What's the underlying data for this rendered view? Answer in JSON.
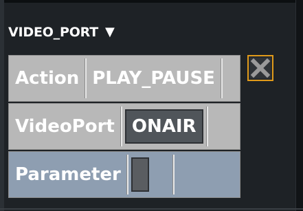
{
  "block": {
    "title": "VIDEO_PORT",
    "toggle_glyph": "▼"
  },
  "rows": {
    "action": {
      "label": "Action",
      "value": "PLAY_PAUSE"
    },
    "videoport": {
      "label": "VideoPort",
      "value": "ONAIR"
    },
    "parameter": {
      "label": "Parameter",
      "value": ""
    }
  },
  "icons": {
    "delete": "close-x-icon"
  },
  "colors": {
    "background": "#1e2226",
    "row_gray": "#b8b8b8",
    "row_blue": "#8e9eb1",
    "accent_orange": "#e09a1a"
  }
}
